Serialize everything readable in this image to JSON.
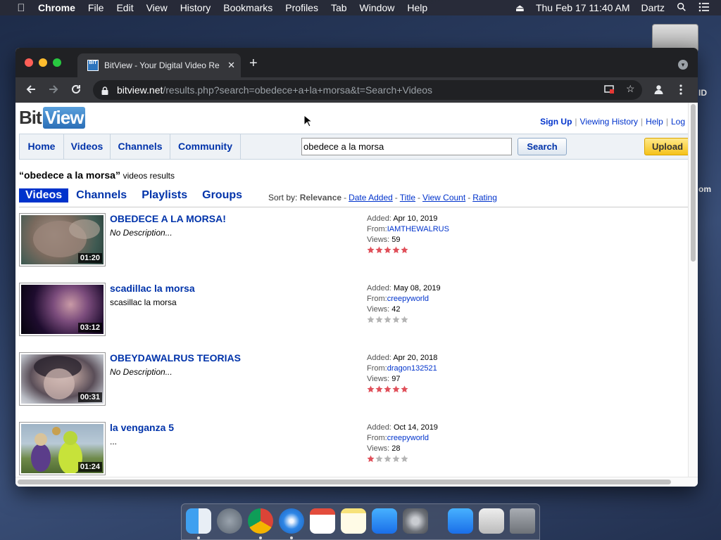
{
  "menubar": {
    "app_name": "Chrome",
    "items": [
      "File",
      "Edit",
      "View",
      "History",
      "Bookmarks",
      "Profiles",
      "Tab",
      "Window",
      "Help"
    ],
    "datetime": "Thu Feb 17  11:40 AM",
    "user": "Dartz"
  },
  "desktop": {
    "label_1": "ID",
    "label_2": "om"
  },
  "browser": {
    "tab_title": "BitView - Your Digital Video Re",
    "url_host": "bitview.net",
    "url_path": "/results.php?search=obedece+a+la+morsa&t=Search+Videos"
  },
  "site": {
    "logo_bit": "Bit",
    "logo_view": "View",
    "user_links": {
      "sign_up": "Sign Up",
      "viewing_history": "Viewing History",
      "help": "Help",
      "log": "Log"
    },
    "nav": {
      "home": "Home",
      "videos": "Videos",
      "channels": "Channels",
      "community": "Community"
    },
    "search_value": "obedece a la morsa",
    "search_button": "Search",
    "upload_button": "Upload",
    "results_query": "“obedece a la morsa”",
    "results_suffix": "videos results",
    "type_tabs": {
      "videos": "Videos",
      "channels": "Channels",
      "playlists": "Playlists",
      "groups": "Groups"
    },
    "sort": {
      "label": "Sort by:",
      "current": "Relevance",
      "date_added": "Date Added",
      "title": "Title",
      "view_count": "View Count",
      "rating": "Rating"
    },
    "meta_labels": {
      "added": "Added:",
      "from": "From:",
      "views": "Views:"
    }
  },
  "results": [
    {
      "title": "OBEDECE A LA MORSA!",
      "description": "No Description...",
      "duration": "01:20",
      "added": "Apr 10, 2019",
      "from": "IAMTHEWALRUS",
      "views": "59",
      "rating": 5
    },
    {
      "title": "scadillac la morsa",
      "description": "scasillac la morsa",
      "duration": "03:12",
      "added": "May 08, 2019",
      "from": "creepyworld",
      "views": "42",
      "rating": 0
    },
    {
      "title": "OBEYDAWALRUS TEORIAS",
      "description": "No Description...",
      "duration": "00:31",
      "added": "Apr 20, 2018",
      "from": "dragon132521",
      "views": "97",
      "rating": 5
    },
    {
      "title": "la venganza 5",
      "description": "...",
      "duration": "01:24",
      "added": "Oct 14, 2019",
      "from": "creepyworld",
      "views": "28",
      "rating": 1
    }
  ],
  "colors": {
    "link_blue": "#0033aa",
    "star_on": "#e0505a",
    "star_off": "#b5b5b5",
    "upload_yellow": "#f5c21a"
  }
}
